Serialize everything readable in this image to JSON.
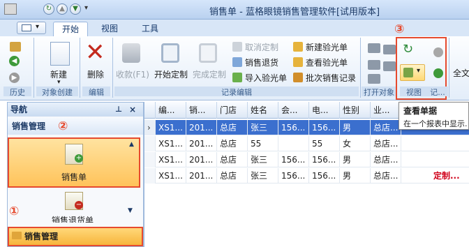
{
  "window": {
    "title": "销售单 - 蓝格眼镜销售管理软件[试用版本]"
  },
  "ribbon": {
    "tabs": [
      "开始",
      "视图",
      "工具"
    ],
    "active_tab": "开始",
    "groups": {
      "history": {
        "label": "历史"
      },
      "create": {
        "label": "对象创建",
        "new_label": "新建"
      },
      "edit": {
        "label": "编辑",
        "delete_label": "删除"
      },
      "record": {
        "label": "记录编辑",
        "collect_label": "收款(F1)",
        "start_custom_label": "开始定制",
        "finish_custom_label": "完成定制",
        "cancel_custom_label": "取消定制",
        "sales_return_label": "销售退货",
        "import_label": "导入验光单",
        "new_optometry_label": "新建验光单",
        "view_optometry_label": "查看验光单",
        "batch_record_label": "批次销售记录"
      },
      "open": {
        "label": "打开对象"
      },
      "view": {
        "label": "视图"
      },
      "record2": {
        "label": "记..."
      },
      "full": {
        "label": "全文"
      }
    }
  },
  "nav": {
    "header": "导航",
    "pin": "ᵖ",
    "close": "×",
    "section": "销售管理",
    "items": [
      {
        "label": "销售单"
      },
      {
        "label": "销售退货单"
      }
    ],
    "bottom": "销售管理"
  },
  "grid": {
    "columns": [
      "编...",
      "销...",
      "门店",
      "姓名",
      "会...",
      "电...",
      "性别",
      "业..."
    ],
    "rows": [
      [
        "XS1...",
        "201...",
        "总店",
        "张三",
        "156...",
        "156...",
        "男",
        "总店..."
      ],
      [
        "XS1...",
        "201...",
        "总店",
        "55",
        "",
        "55",
        "女",
        "总店..."
      ],
      [
        "XS1...",
        "201...",
        "总店",
        "张三",
        "156...",
        "156...",
        "男",
        "总店..."
      ],
      [
        "XS1...",
        "201...",
        "总店",
        "张三",
        "156...",
        "156...",
        "男",
        "总店..."
      ]
    ],
    "extra": "定制..."
  },
  "tooltip": {
    "title": "查看单据",
    "desc": "在一个报表中显示..."
  },
  "markers": {
    "one": "①",
    "two": "②",
    "three": "③"
  },
  "colors": {
    "highlight": "#e64a2e",
    "selected_row": "#3b6fce"
  }
}
